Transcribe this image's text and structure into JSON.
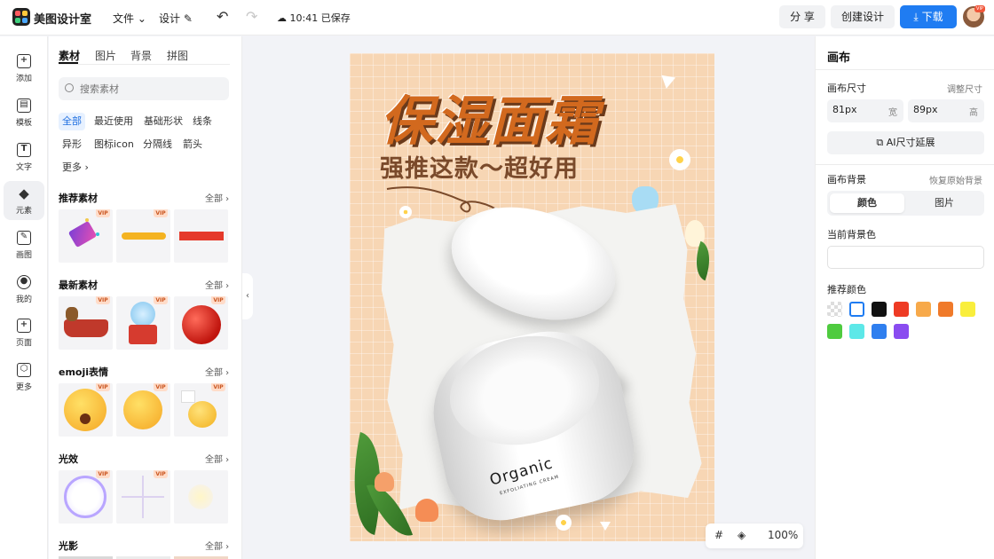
{
  "header": {
    "app_name": "美图设计室",
    "menu_file": "文件",
    "menu_design": "设计",
    "save_status": "10:41 已保存",
    "share_label": "分 享",
    "create_label": "创建设计",
    "download_label": "下载",
    "vip_badge": "VIP"
  },
  "rail": {
    "items": [
      {
        "label": "添加",
        "icon": "plus-square-icon"
      },
      {
        "label": "模板",
        "icon": "template-icon"
      },
      {
        "label": "文字",
        "icon": "text-icon"
      },
      {
        "label": "元素",
        "icon": "shapes-icon"
      },
      {
        "label": "画图",
        "icon": "pen-icon"
      },
      {
        "label": "我的",
        "icon": "user-icon"
      },
      {
        "label": "页面",
        "icon": "page-add-icon"
      },
      {
        "label": "更多",
        "icon": "cube-icon"
      }
    ],
    "active_index": 3
  },
  "panel": {
    "tabs": [
      "素材",
      "图片",
      "背景",
      "拼图"
    ],
    "search_placeholder": "搜索素材",
    "chips": [
      "全部",
      "最近使用",
      "基础形状",
      "线条",
      "异形",
      "图标icon",
      "分隔线",
      "箭头",
      "更多"
    ],
    "all_label": "全部",
    "vip_label": "VIP",
    "sections": [
      {
        "title": "推荐素材"
      },
      {
        "title": "最新素材"
      },
      {
        "title": "emoji表情"
      },
      {
        "title": "光效"
      },
      {
        "title": "光影"
      }
    ]
  },
  "poster": {
    "title": "保湿面霜",
    "subtitle": "强推这款～超好用",
    "brand": "Organic",
    "tagline": "EXFOLIATING CREAM"
  },
  "canvas_tools": {
    "zoom": "100%"
  },
  "right_panel": {
    "title": "画布",
    "size_label": "画布尺寸",
    "adjust_size": "调整尺寸",
    "width_value": "81px",
    "width_unit": "宽",
    "height_value": "89px",
    "height_unit": "高",
    "ai_extend": "AI尺寸延展",
    "bg_label": "画布背景",
    "restore_bg": "恢复原始背景",
    "seg_color": "颜色",
    "seg_image": "图片",
    "current_bg_label": "当前背景色",
    "recommended_label": "推荐颜色",
    "colors": [
      "transparent",
      "#ffffff",
      "#111111",
      "#ee3b24",
      "#f7a94a",
      "#f07a2a",
      "#f9ee3c",
      "#4fcb3f",
      "#5de8e8",
      "#2f7fef",
      "#8a4cf0"
    ]
  }
}
